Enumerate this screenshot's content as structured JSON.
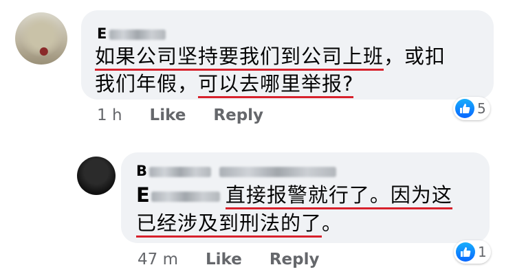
{
  "comment": {
    "author_initial": "E",
    "line1_pre": "如果公司坚持要我们到公司上班",
    "line1_post": "，或扣",
    "line2_pre": "我们年假，",
    "line2_ul": "可以去哪里举报?",
    "time": "1 h",
    "like_label": "Like",
    "reply_label": "Reply",
    "reaction_count": "5",
    "reaction_icon": "thumbs-up-icon"
  },
  "reply": {
    "author_initial": "B",
    "mention_initial": "E",
    "line1_ul": "直接报警就行了。因为这",
    "line2_ul": "已经涉及到刑法的了",
    "line2_post": "。",
    "time": "47 m",
    "like_label": "Like",
    "reply_label": "Reply",
    "reaction_count": "1",
    "reaction_icon": "thumbs-up-icon"
  },
  "colors": {
    "underline": "#d7202b",
    "bubble": "#f0f2f5",
    "like_blue": "#0866ff",
    "meta_gray": "#65676b"
  }
}
